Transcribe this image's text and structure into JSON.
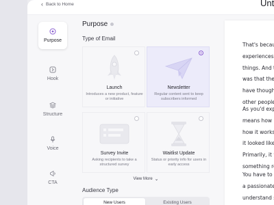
{
  "header": {
    "back_label": "Back to Home",
    "doc_title": "Untitled"
  },
  "sidebar": {
    "items": [
      {
        "label": "Purpose",
        "icon": "target-icon",
        "active": true
      },
      {
        "label": "Hook",
        "icon": "hook-icon",
        "active": false
      },
      {
        "label": "Structure",
        "icon": "layers-icon",
        "active": false
      },
      {
        "label": "Voice",
        "icon": "microphone-icon",
        "active": false
      },
      {
        "label": "CTA",
        "icon": "megaphone-icon",
        "active": false
      }
    ]
  },
  "main": {
    "title": "Purpose",
    "type_label": "Type of Email",
    "cards": [
      {
        "title": "Launch",
        "desc": "Introduces a new product, feature or initiative",
        "icon": "rocket-icon",
        "selected": false
      },
      {
        "title": "Newsletter",
        "desc": "Regular content sent to keep subscribers informed",
        "icon": "paper-plane-icon",
        "selected": true
      },
      {
        "title": "Survey Invite",
        "desc": "Asking recipients to take a structured survey",
        "icon": "form-icon",
        "selected": false
      },
      {
        "title": "Waitlist Update",
        "desc": "Status or priority info for users in early access",
        "icon": "hourglass-icon",
        "selected": false
      }
    ],
    "view_more": "View More",
    "audience_label": "Audience Type",
    "audience_options": [
      "New Users",
      "Existing Users"
    ]
  },
  "preview": {
    "para1": [
      "That's becau",
      "experiences",
      "things. And t",
      "was that they",
      "have thought",
      "other people"
    ],
    "para2": [
      "As you'd exp",
      "means how it",
      "how it works.",
      "it looked like",
      "Primarily, it w",
      "something re"
    ],
    "para3": [
      "You have to r",
      "a passionate",
      "understand s"
    ]
  },
  "colors": {
    "accent": "#8a5fd0",
    "selected_bg": "#ecebfa"
  }
}
